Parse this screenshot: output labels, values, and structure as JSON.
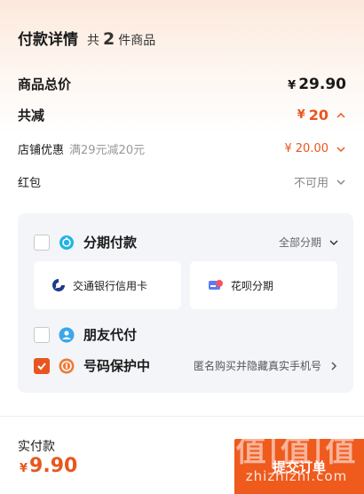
{
  "header": {
    "title": "付款详情",
    "count_prefix": "共",
    "count": "2",
    "count_suffix": "件商品"
  },
  "summary": {
    "total_label": "商品总价",
    "total_currency": "¥",
    "total_value": "29.90",
    "discount_label": "共减",
    "discount_currency": "¥",
    "discount_value": "20",
    "store_label": "店铺优惠",
    "store_desc": "满29元减20元",
    "store_currency": "¥",
    "store_value": "20.00",
    "redpacket_label": "红包",
    "redpacket_value": "不可用"
  },
  "options": {
    "installment": {
      "label": "分期付款",
      "right": "全部分期",
      "checked": false
    },
    "cards": [
      {
        "label": "交通银行信用卡"
      },
      {
        "label": "花呗分期"
      }
    ],
    "friend_pay": {
      "label": "朋友代付",
      "checked": false
    },
    "number_protect": {
      "label": "号码保护中",
      "right": "匿名购买并隐藏真实手机号",
      "checked": true
    }
  },
  "footer": {
    "pay_label": "实付款",
    "pay_currency": "¥",
    "pay_value": "9.90",
    "submit_label": "提交订单"
  },
  "watermark": {
    "glyph": "值|值|值",
    "text": "zhizhizhi.com"
  },
  "colors": {
    "accent": "#e8561f",
    "submit": "#ef5a1d",
    "panel_bg": "#f3f5f9"
  },
  "icons": [
    "installment-icon",
    "bocom-icon",
    "huabei-icon",
    "friend-pay-icon",
    "phone-protect-icon",
    "chevron-down-icon",
    "chevron-up-icon",
    "chevron-right-icon",
    "check-icon"
  ]
}
